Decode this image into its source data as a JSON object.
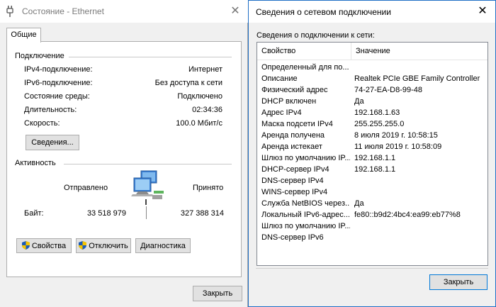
{
  "status_window": {
    "title": "Состояние - Ethernet",
    "tab": "Общие",
    "connection": {
      "heading": "Подключение",
      "rows": [
        {
          "label": "IPv4-подключение:",
          "value": "Интернет"
        },
        {
          "label": "IPv6-подключение:",
          "value": "Без доступа к сети"
        },
        {
          "label": "Состояние среды:",
          "value": "Подключено"
        },
        {
          "label": "Длительность:",
          "value": "02:34:36"
        },
        {
          "label": "Скорость:",
          "value": "100.0 Мбит/с"
        }
      ],
      "details_button": "Сведения..."
    },
    "activity": {
      "heading": "Активность",
      "sent_label": "Отправлено",
      "received_label": "Принято",
      "bytes_label": "Байт:",
      "sent_bytes": "33 518 979",
      "received_bytes": "327 388 314"
    },
    "buttons": {
      "properties": "Свойства",
      "disable": "Отключить",
      "diagnostics": "Диагностика",
      "close": "Закрыть"
    }
  },
  "details_window": {
    "title": "Сведения о сетевом подключении",
    "caption": "Сведения о подключении к сети:",
    "columns": [
      "Свойство",
      "Значение"
    ],
    "rows": [
      {
        "property": "Определенный для по...",
        "value": ""
      },
      {
        "property": "Описание",
        "value": "Realtek PCIe GBE Family Controller"
      },
      {
        "property": "Физический адрес",
        "value": "74-27-EA-D8-99-48"
      },
      {
        "property": "DHCP включен",
        "value": "Да"
      },
      {
        "property": "Адрес IPv4",
        "value": "192.168.1.63"
      },
      {
        "property": "Маска подсети IPv4",
        "value": "255.255.255.0"
      },
      {
        "property": "Аренда получена",
        "value": "8 июля 2019 г. 10:58:15"
      },
      {
        "property": "Аренда истекает",
        "value": "11 июля 2019 г. 10:58:09"
      },
      {
        "property": "Шлюз по умолчанию IP...",
        "value": "192.168.1.1"
      },
      {
        "property": "DHCP-сервер IPv4",
        "value": "192.168.1.1"
      },
      {
        "property": "DNS-сервер IPv4",
        "value": ""
      },
      {
        "property": "WINS-сервер IPv4",
        "value": ""
      },
      {
        "property": "Служба NetBIOS через...",
        "value": "Да"
      },
      {
        "property": "Локальный IPv6-адрес...",
        "value": "fe80::b9d2:4bc4:ea99:eb77%8"
      },
      {
        "property": "Шлюз по умолчанию IP...",
        "value": ""
      },
      {
        "property": "DNS-сервер IPv6",
        "value": ""
      }
    ],
    "close_button": "Закрыть"
  },
  "colors": {
    "accent": "#0078d7",
    "window_bg": "#f0f0f0",
    "border": "#adadad"
  }
}
